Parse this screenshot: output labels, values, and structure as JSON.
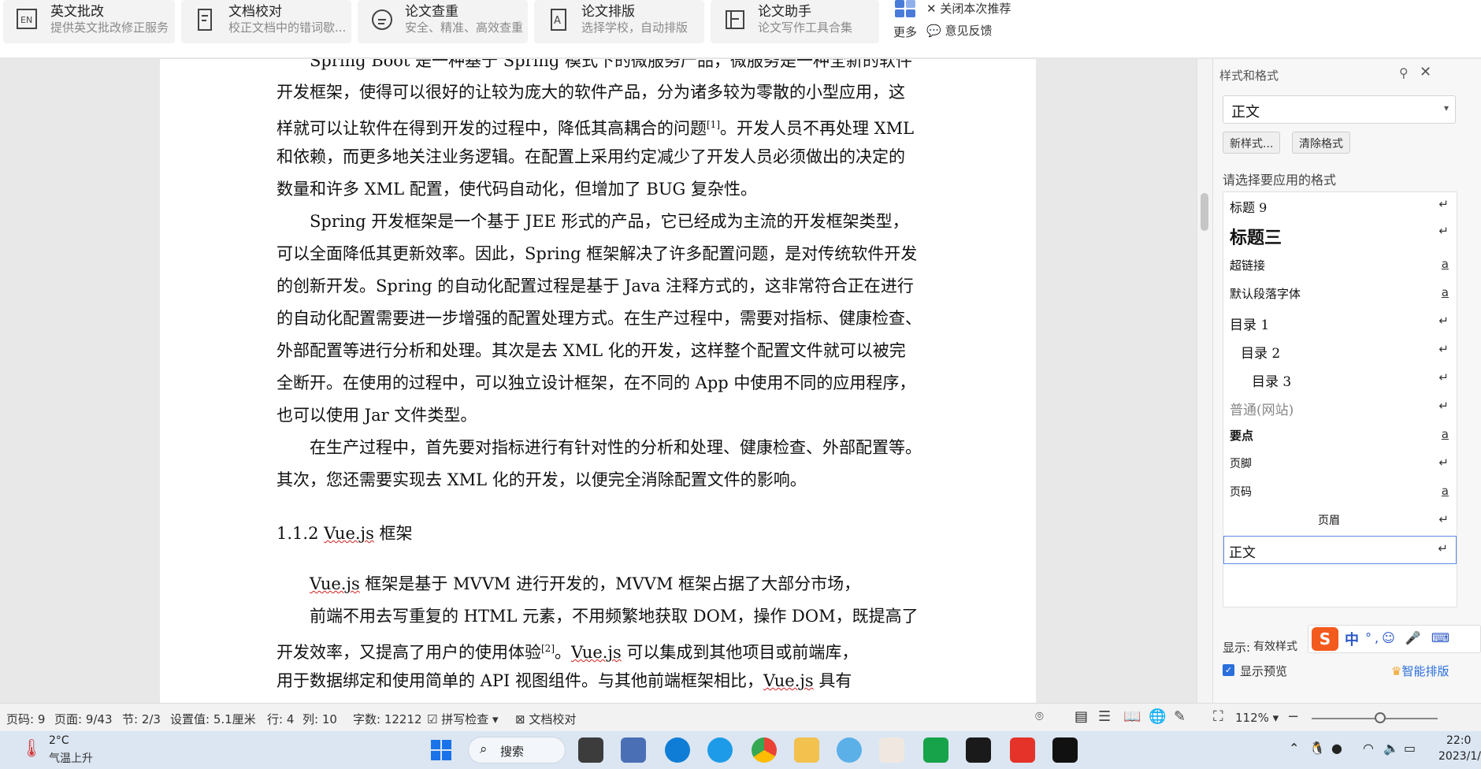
{
  "toolbar": {
    "tools": [
      {
        "title": "英文批改",
        "subtitle": "提供英文批改修正服务",
        "icon": "en-correct-icon"
      },
      {
        "title": "文档校对",
        "subtitle": "校正文档中的错词歇...",
        "icon": "doc-proofread-icon"
      },
      {
        "title": "论文查重",
        "subtitle": "安全、精准、高效查重",
        "icon": "paper-check-icon"
      },
      {
        "title": "论文排版",
        "subtitle": "选择学校，自动排版",
        "icon": "paper-format-icon"
      },
      {
        "title": "论文助手",
        "subtitle": "论文写作工具合集",
        "icon": "paper-assistant-icon"
      }
    ],
    "more_label": "更多",
    "close_recommend": "关闭本次推荐",
    "feedback": "意见反馈"
  },
  "document": {
    "paragraphs": [
      "Spring Boot 是一种基于 Spring 模式下的微服务产品，微服务是一种全新的软件",
      "开发框架，使得可以很好的让较为庞大的软件产品，分为诸多较为零散的小型应用，这",
      "样就可以让软件在得到开发的过程中，降低其高耦合的问题",
      "。开发人员不再处理 XML",
      "和依赖，而更多地关注业务逻辑。在配置上采用约定减少了开发人员必须做出的决定的",
      "数量和许多 XML 配置，使代码自动化，但增加了 BUG 复杂性。",
      "Spring 开发框架是一个基于 JEE 形式的产品，它已经成为主流的开发框架类型，",
      "可以全面降低其更新效率。因此，Spring 框架解决了许多配置问题，是对传统软件开发",
      "的创新开发。Spring 的自动化配置过程是基于 Java 注释方式的，这非常符合正在进行",
      "的自动化配置需要进一步增强的配置处理方式。在生产过程中，需要对指标、健康检查、",
      "外部配置等进行分析和处理。其次是去 XML 化的开发，这样整个配置文件就可以被完",
      "全断开。在使用的过程中，可以独立设计框架，在不同的 App 中使用不同的应用程序，",
      "也可以使用 Jar 文件类型。",
      "在生产过程中，首先要对指标进行有针对性的分析和处理、健康检查、外部配置等。",
      "其次，您还需要实现去 XML 化的开发，以便完全消除配置文件的影响。"
    ],
    "ref1": "[1]",
    "heading_num": "1.1.2 ",
    "heading_vue": "Vue.js",
    "heading_rest": " 框架",
    "vue_p1_vue": "Vue.js",
    "vue_p1_rest": " 框架是基于 MVVM 进行开发的，MVVM 框架占据了大部分市场，",
    "vue_p2": "前端不用去写重复的 HTML 元素，不用频繁地获取 DOM，操作 DOM，既提高了",
    "vue_p3_a": "开发效率，又提高了用户的使用体验",
    "ref2": "[2]",
    "vue_p3_b": "。",
    "vue_p3_vue": "Vue.js",
    "vue_p3_c": " 可以集成到其他项目或前端库，",
    "vue_p4_a": "用于数据绑定和使用简单的 API 视图组件。与其他前端框架相比，",
    "vue_p4_vue": "Vue.js",
    "vue_p4_b": " 具有"
  },
  "panel": {
    "title": "样式和格式",
    "current_style": "正文",
    "new_style": "新样式...",
    "clear_format": "清除格式",
    "choose_label": "请选择要应用的格式",
    "styles": [
      {
        "name": "标题 9",
        "mark": "↵"
      },
      {
        "name": "标题三",
        "mark": "↵"
      },
      {
        "name": "超链接",
        "mark": "a"
      },
      {
        "name": "默认段落字体",
        "mark": "a"
      },
      {
        "name": "目录 1",
        "mark": "↵"
      },
      {
        "name": "目录 2",
        "mark": "↵"
      },
      {
        "name": "目录 3",
        "mark": "↵"
      },
      {
        "name": "普通(网站)",
        "mark": "↵"
      },
      {
        "name": "要点",
        "mark": "a"
      },
      {
        "name": "页脚",
        "mark": "↵"
      },
      {
        "name": "页码",
        "mark": "a"
      },
      {
        "name": "页眉",
        "mark": "↵"
      },
      {
        "name": "正文",
        "mark": "↵"
      }
    ],
    "show_label": "显示:",
    "show_value": "有效样式",
    "preview_label": "显示预览",
    "smart_layout": "智能排版"
  },
  "ime": {
    "logo": "S",
    "mode": "中",
    "rest": "°,☺ 🎤 ⌨"
  },
  "status": {
    "page_code": "页码: 9",
    "page": "页面: 9/43",
    "section": "节: 2/3",
    "setting": "设置值: 5.1厘米",
    "row": "行: 4",
    "col": "列: 10",
    "words": "字数: 12212",
    "spell": "拼写检查",
    "proof": "文档校对",
    "zoom": "112%"
  },
  "taskbar": {
    "temp": "2°C",
    "weather": "气温上升",
    "search": "搜索",
    "time": "22:0",
    "date": "2023/1/"
  },
  "colors": {
    "accent": "#2a6fdb",
    "wps_red": "#e5332a",
    "squiggle": "#d02020"
  }
}
